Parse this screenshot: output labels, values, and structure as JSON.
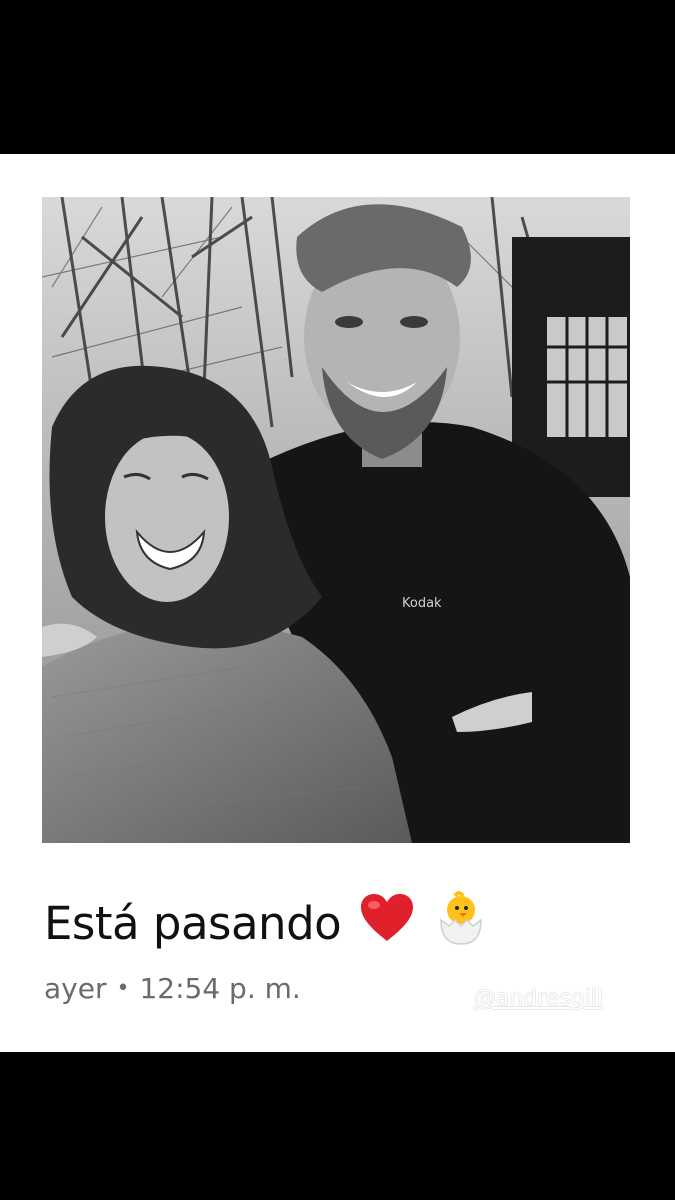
{
  "post": {
    "caption": "Está pasando",
    "emojis": [
      "red-heart",
      "hatching-chick"
    ],
    "time_day": "ayer",
    "time_separator": "•",
    "time_clock": "12:54 p. m.",
    "watermark": "@andresgill",
    "photo_brand_text": "Kodak"
  },
  "colors": {
    "background": "#000000",
    "card": "#ffffff",
    "caption_text": "#111111",
    "meta_text": "#6b6b6b",
    "heart": "#e0202a"
  }
}
